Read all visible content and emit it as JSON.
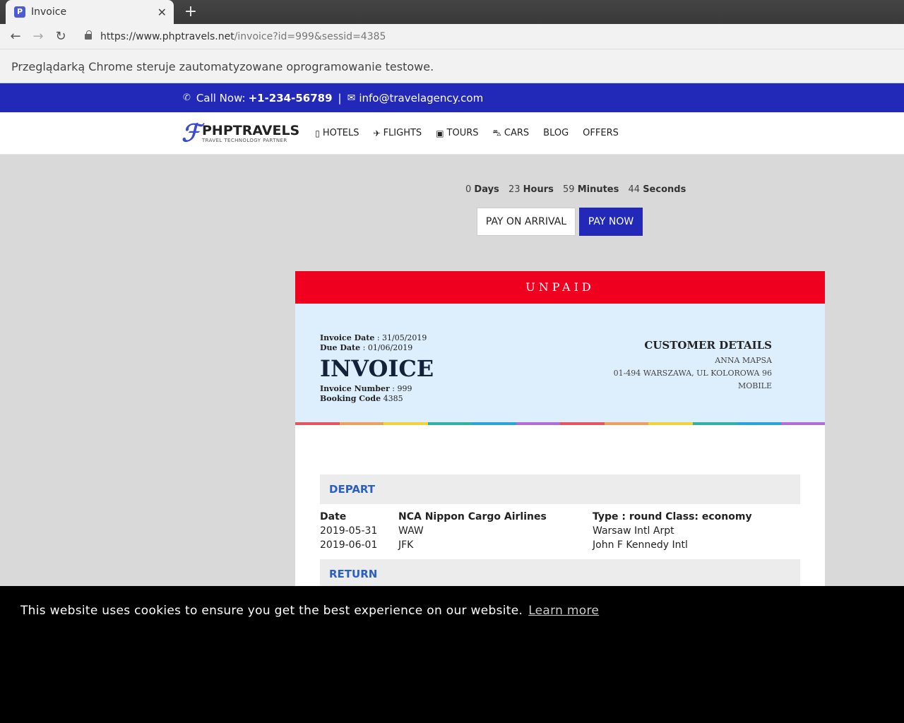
{
  "browser": {
    "tab_title": "Invoice",
    "favicon_glyph": "P",
    "url_host": "https://www.phptravels.net",
    "url_path": "/invoice?id=999&sessid=4385",
    "automation_notice": "Przeglądarką Chrome steruje zautomatyzowane oprogramowanie testowe."
  },
  "topbar": {
    "call_label": "Call Now:",
    "phone": "+1-234-56789",
    "separator": "|",
    "email": "info@travelagency.com"
  },
  "logo": {
    "name": "PHPTRAVELS",
    "tagline": "TRAVEL TECHNOLOGY PARTNER"
  },
  "menu": {
    "hotels": "HOTELS",
    "flights": "FLIGHTS",
    "tours": "TOURS",
    "cars": "CARS",
    "blog": "BLOG",
    "offers": "OFFERS"
  },
  "countdown": {
    "days": "0",
    "days_label": "Days",
    "hours": "23",
    "hours_label": "Hours",
    "minutes": "59",
    "minutes_label": "Minutes",
    "seconds": "44",
    "seconds_label": "Seconds"
  },
  "actions": {
    "pay_on_arrival": "PAY ON ARRIVAL",
    "pay_now": "PAY NOW"
  },
  "invoice": {
    "status": "UNPAID",
    "date_label": "Invoice Date",
    "date": ": 31/05/2019",
    "due_label": "Due Date",
    "due": ": 01/06/2019",
    "title": "INVOICE",
    "number_label": "Invoice Number",
    "number": ": 999",
    "booking_label": "Booking Code",
    "booking": "4385"
  },
  "customer": {
    "heading": "CUSTOMER DETAILS",
    "name": "ANNA MAPSA",
    "address": "01-494 WARSZAWA, UL KOLOROWA 96",
    "phone": "MOBILE"
  },
  "depart": {
    "heading": "DEPART",
    "col_date": "Date",
    "airline": "NCA Nippon Cargo Airlines",
    "type_class": "Type : round Class: economy",
    "rows": [
      {
        "date": "2019-05-31",
        "code": "WAW",
        "airport": "Warsaw Intl Arpt"
      },
      {
        "date": "2019-06-01",
        "code": "JFK",
        "airport": "John F Kennedy Intl"
      }
    ]
  },
  "return": {
    "heading": "RETURN"
  },
  "cookie": {
    "message": "This website uses cookies to ensure you get the best experience on our website.",
    "link": "Learn more"
  },
  "colors": {
    "brand_blue": "#2229b9",
    "unpaid_red": "#f0001e",
    "invoice_bg": "#ddeefd",
    "rainbow": [
      "#e8545e",
      "#f0a05a",
      "#f2d43a",
      "#2fb3a0",
      "#27a5d8",
      "#b46ad9"
    ]
  }
}
